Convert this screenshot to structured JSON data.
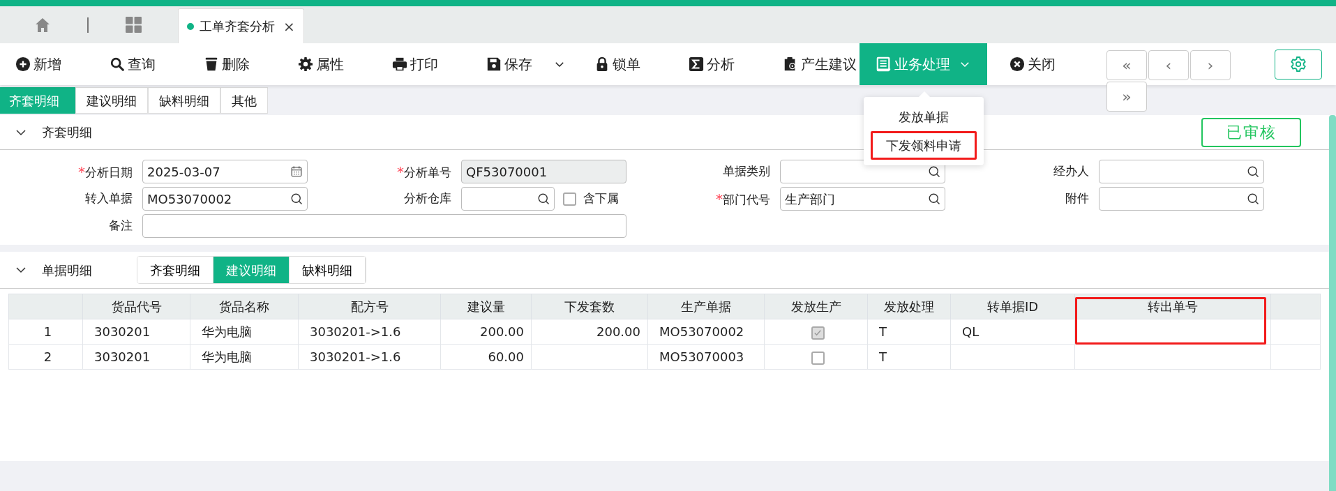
{
  "app_tabs": [
    {
      "label": "工单齐套分析",
      "selected": true,
      "close": "×"
    }
  ],
  "toolbar": [
    {
      "label": "新增",
      "kind": "plus",
      "active": false,
      "dropdown": false
    },
    {
      "label": "查询",
      "kind": "search",
      "active": false,
      "dropdown": false
    },
    {
      "label": "删除",
      "kind": "trash",
      "active": false,
      "dropdown": false
    },
    {
      "label": "属性",
      "kind": "gear",
      "active": false,
      "dropdown": false
    },
    {
      "label": "打印",
      "kind": "printer",
      "active": false,
      "dropdown": false
    },
    {
      "label": "保存",
      "kind": "save",
      "active": false,
      "dropdown": true
    },
    {
      "label": "锁单",
      "kind": "lock",
      "active": false,
      "dropdown": false
    },
    {
      "label": "分析",
      "kind": "sigma",
      "active": false,
      "dropdown": false
    },
    {
      "label": "产生建议",
      "kind": "clipboard",
      "active": false,
      "dropdown": false
    },
    {
      "label": "业务处理",
      "kind": "document",
      "active": true,
      "dropdown": true
    },
    {
      "label": "关闭",
      "kind": "close",
      "active": false,
      "dropdown": false
    }
  ],
  "pager": [
    "«",
    "‹",
    "›",
    "»"
  ],
  "dropdown_menu": [
    {
      "label": "发放单据",
      "highlighted": false
    },
    {
      "label": "下发领料申请",
      "highlighted": true
    }
  ],
  "page_tabs": [
    {
      "label": "齐套明细",
      "selected": true
    },
    {
      "label": "建议明细",
      "selected": false
    },
    {
      "label": "缺料明细",
      "selected": false
    },
    {
      "label": "其他",
      "selected": false
    }
  ],
  "header_section": {
    "title": "齐套明细",
    "expanded": true,
    "status": "已审核"
  },
  "form": [
    [
      {
        "label": "分析日期",
        "marker": "*",
        "kind": "date",
        "value": "2025-03-07"
      },
      {
        "label": "分析单号",
        "marker": "*",
        "kind": "readonly",
        "value": "QF53070001"
      },
      {
        "label": "单据类别",
        "kind": "lookup"
      },
      {
        "label": "经办人",
        "kind": "lookup"
      }
    ],
    [
      {
        "label": "转入单据",
        "kind": "lookup",
        "value": "MO53070002"
      },
      {
        "label": "分析仓库",
        "kind": "lookup",
        "option": {
          "label": "含下属",
          "checked": false
        }
      },
      {
        "label": "部门代号",
        "marker": "*",
        "kind": "lookup",
        "value": "生产部门"
      },
      {
        "label": "附件",
        "kind": "lookup"
      }
    ],
    [
      {
        "label": "备注",
        "kind": "wide"
      }
    ]
  ],
  "detail_section": {
    "title": "单据明细",
    "expanded": true,
    "tabs": [
      {
        "label": "齐套明细",
        "selected": false
      },
      {
        "label": "建议明细",
        "selected": true
      },
      {
        "label": "缺料明细",
        "selected": false
      }
    ]
  },
  "table": {
    "columns": [
      {
        "kind": "index",
        "highlighted": false
      },
      {
        "label": "货品代号",
        "kind": "text",
        "highlighted": false
      },
      {
        "label": "货品名称",
        "kind": "text",
        "highlighted": false
      },
      {
        "label": "配方号",
        "kind": "text",
        "highlighted": false
      },
      {
        "label": "建议量",
        "kind": "number",
        "highlighted": false
      },
      {
        "label": "下发套数",
        "kind": "number",
        "highlighted": false
      },
      {
        "label": "生产单据",
        "kind": "text",
        "highlighted": false
      },
      {
        "label": "发放生产",
        "kind": "check",
        "highlighted": false
      },
      {
        "label": "发放处理",
        "kind": "text",
        "highlighted": false
      },
      {
        "label": "转单据ID",
        "kind": "text",
        "highlighted": false
      },
      {
        "label": "转出单号",
        "kind": "text",
        "highlighted": true
      },
      {
        "kind": "text",
        "highlighted": false
      }
    ],
    "rows": [
      {
        "cells": [
          "1",
          "3030201",
          "华为电脑",
          "3030201->1.6",
          "200.00",
          "200.00",
          "MO53070002",
          {
            "checked": true
          },
          "T",
          "QL",
          null,
          null
        ]
      },
      {
        "cells": [
          "2",
          "3030201",
          "华为电脑",
          "3030201->1.6",
          "60.00",
          null,
          "MO53070003",
          {
            "checked": false
          },
          "T",
          null,
          null,
          null
        ]
      }
    ]
  }
}
